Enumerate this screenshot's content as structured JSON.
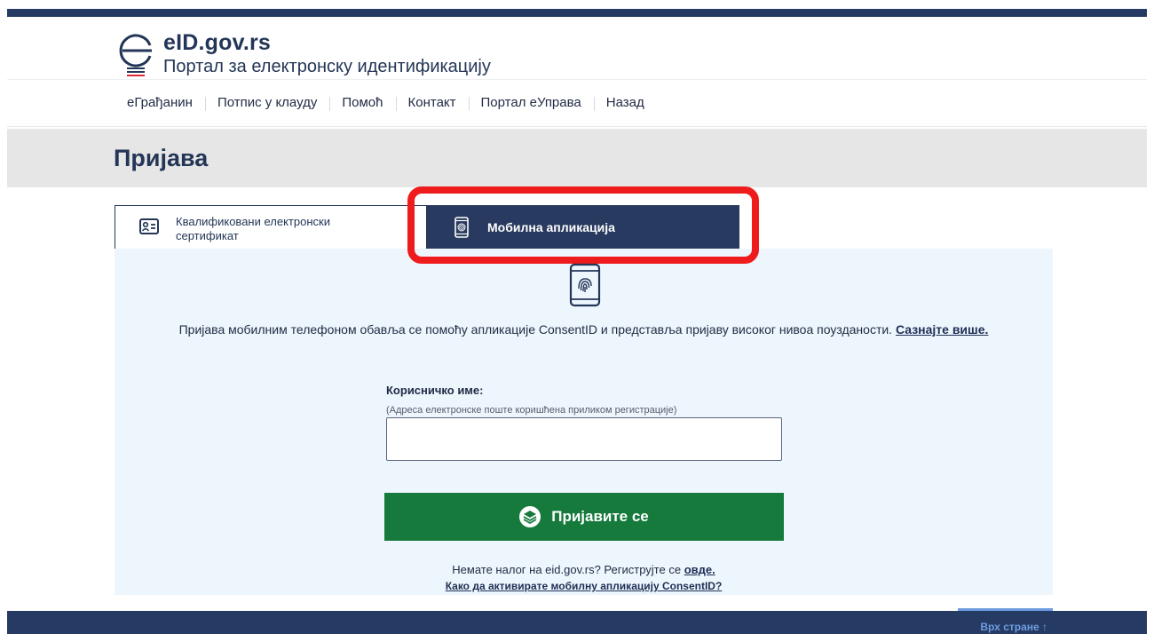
{
  "header": {
    "logo_title": "eID.gov.rs",
    "logo_subtitle": "Портал за електронску идентификацију"
  },
  "nav": {
    "items": [
      {
        "label": "еГрађанин"
      },
      {
        "label": "Потпис у клауду"
      },
      {
        "label": "Помоћ"
      },
      {
        "label": "Контакт"
      },
      {
        "label": "Портал еУправа"
      },
      {
        "label": "Назад"
      }
    ]
  },
  "page": {
    "title": "Пријава"
  },
  "tabs": {
    "certificate": {
      "label": "Квалификовани електронски сертификат",
      "icon": "id-card-icon"
    },
    "mobile": {
      "label": "Мобилна апликација",
      "icon": "phone-fingerprint-icon",
      "active": true
    }
  },
  "mobile_login": {
    "intro_text": "Пријава мобилним телефоном обавља се помоћу апликације ConsentID и представља пријаву високог нивоа поузданости.",
    "learn_more": "Сазнајте више.",
    "username_label": "Корисничко име:",
    "username_hint": "(Адреса електронске поште коришћена приликом регистрације)",
    "username_value": "",
    "login_button": "Пријавите се",
    "register_text": "Немате налог на eid.gov.rs? Региструјте се",
    "register_link": "овде.",
    "activate_link": "Како да активирате мобилну апликацију ConsentID?"
  },
  "footer": {
    "back_to_top": "Врх стране ↑"
  },
  "colors": {
    "navy": "#263b63",
    "highlight": "#ee1c1c",
    "button_green": "#157a3c",
    "panel_bg": "#eef6fd"
  }
}
